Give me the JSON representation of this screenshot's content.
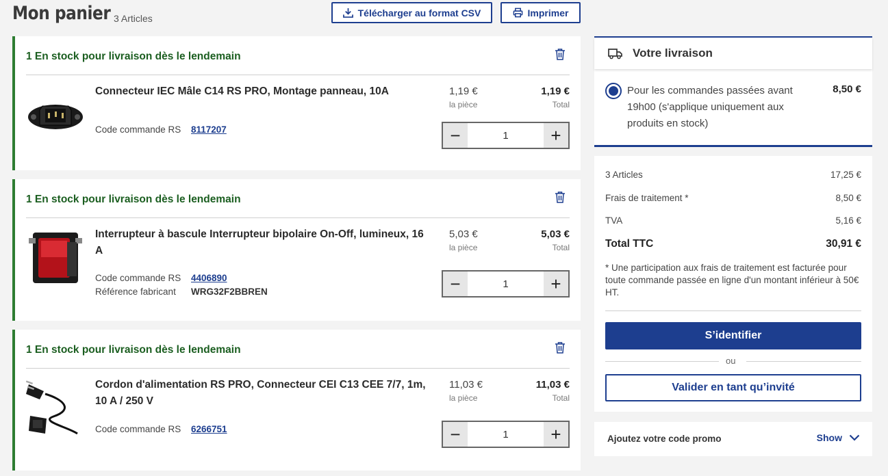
{
  "header": {
    "title": "Mon panier",
    "article_count": "3 Articles",
    "csv_button": "Télécharger au format CSV",
    "print_button": "Imprimer"
  },
  "items": [
    {
      "stock": "1 En stock pour livraison dès le lendemain",
      "name": "Connecteur IEC Mâle C14 RS PRO, Montage panneau, 10A",
      "code_label": "Code commande RS",
      "code": "8117207",
      "mfr_label": "",
      "mfr": "",
      "unit_price": "1,19 €",
      "unit_label": "la pièce",
      "total_price": "1,19 €",
      "total_label": "Total",
      "qty": "1"
    },
    {
      "stock": "1 En stock pour livraison dès le lendemain",
      "name": "Interrupteur à bascule Interrupteur bipolaire On-Off, lumineux, 16 A",
      "code_label": "Code commande RS",
      "code": "4406890",
      "mfr_label": "Référence fabricant",
      "mfr": "WRG32F2BBREN",
      "unit_price": "5,03 €",
      "unit_label": "la pièce",
      "total_price": "5,03 €",
      "total_label": "Total",
      "qty": "1"
    },
    {
      "stock": "1 En stock pour livraison dès le lendemain",
      "name": "Cordon d'alimentation RS PRO, Connecteur CEI C13 CEE 7/7, 1m, 10 A / 250 V",
      "code_label": "Code commande RS",
      "code": "6266751",
      "mfr_label": "",
      "mfr": "",
      "unit_price": "11,03 €",
      "unit_label": "la pièce",
      "total_price": "11,03 €",
      "total_label": "Total",
      "qty": "1"
    }
  ],
  "qty_minus": "−",
  "qty_plus": "+",
  "delivery": {
    "title": "Votre livraison",
    "option_text": "Pour les commandes passées avant 19h00 (s'applique uniquement aux produits en stock)",
    "option_price": "8,50 €"
  },
  "summary": {
    "articles_label": "3 Articles",
    "articles_value": "17,25 €",
    "fees_label": "Frais de traitement *",
    "fees_value": "8,50 €",
    "vat_label": "TVA",
    "vat_value": "5,16 €",
    "total_label": "Total TTC",
    "total_value": "30,91 €",
    "note": "* Une participation aux frais de traitement est facturée pour toute commande passée en ligne d'un montant inférieur à 50€ HT.",
    "login_button": "S’identifier",
    "or_text": "ou",
    "guest_button": "Valider en tant qu’invité"
  },
  "promo": {
    "label": "Ajoutez votre code promo",
    "toggle": "Show"
  },
  "colors": {
    "brand_blue": "#1d3e8f",
    "stock_green": "#2e7d32",
    "background": "#f3f3f3"
  }
}
